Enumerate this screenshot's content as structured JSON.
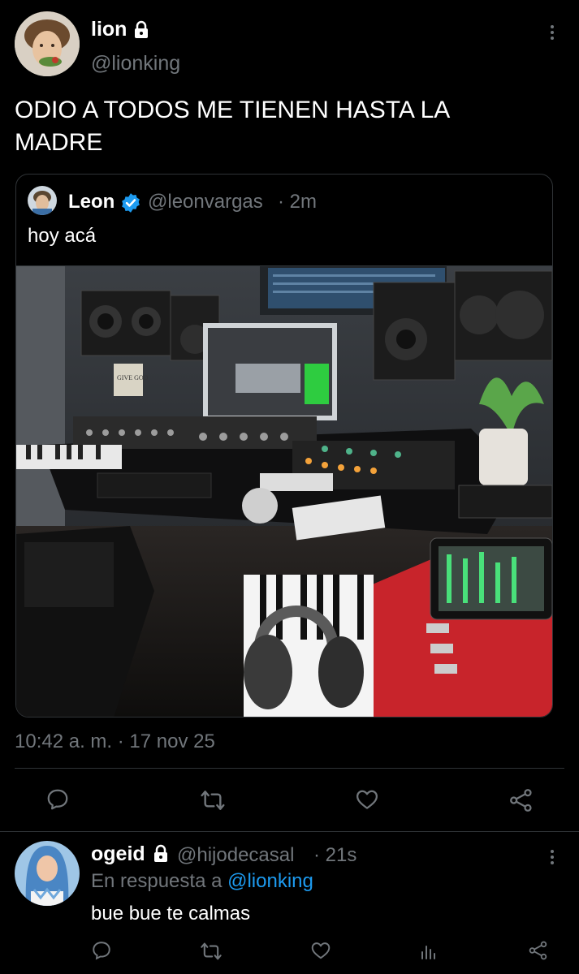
{
  "tweet": {
    "author_name": "lion",
    "author_handle": "@lionking",
    "text": "ODIO A TODOS ME TIENEN HASTA LA MADRE",
    "timestamp": "10:42 a. m. · 17 nov 25"
  },
  "quoted": {
    "author_name": "Leon",
    "author_handle": "@leonvargas",
    "time": "· 2m",
    "text": "hoy acá",
    "image_text": "GIVE GOD"
  },
  "reply": {
    "author_name": "ogeid",
    "author_handle": "@hijodecasal",
    "time": "· 21s",
    "reply_prefix": "En respuesta a",
    "reply_to": "@lionking",
    "text": "bue bue te calmas"
  },
  "colors": {
    "background": "#000000",
    "text": "#e7e9ea",
    "muted": "#71767b",
    "accent": "#1d9bf0",
    "verified": "#1d9bf0"
  },
  "icons": [
    "lock-icon",
    "verified-icon",
    "more-icon",
    "reply-icon",
    "retweet-icon",
    "like-icon",
    "share-icon",
    "views-icon"
  ]
}
